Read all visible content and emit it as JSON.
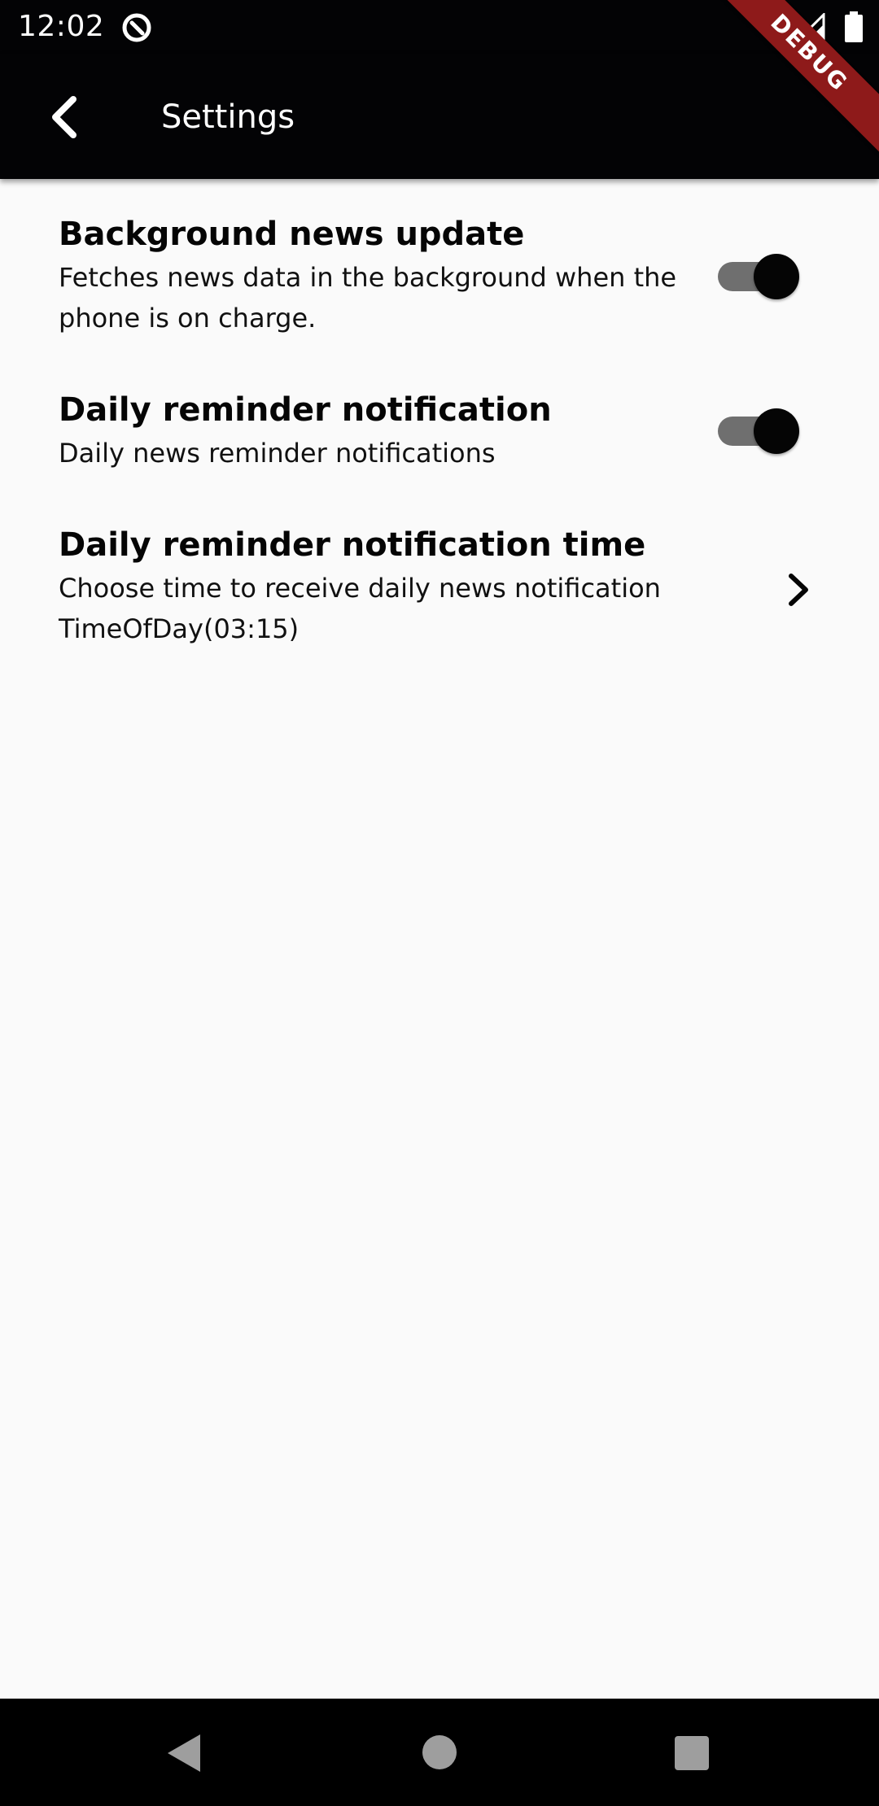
{
  "status_bar": {
    "time": "12:02",
    "icons": [
      "app-notification-icon",
      "wifi-icon",
      "signal-icon",
      "battery-icon"
    ]
  },
  "app_bar": {
    "title": "Settings",
    "back_icon": "back-arrow-icon"
  },
  "debug_banner": "DEBUG",
  "settings": {
    "background_update": {
      "title": "Background news update",
      "subtitle": "Fetches news data in the background when the phone is on charge.",
      "enabled": true
    },
    "daily_reminder": {
      "title": "Daily reminder notification",
      "subtitle": "Daily news reminder notifications",
      "enabled": true
    },
    "reminder_time": {
      "title": "Daily reminder notification time",
      "subtitle_line1": "Choose time to receive daily news notification",
      "subtitle_line2": "TimeOfDay(03:15)",
      "trailing_icon": "chevron-right-icon"
    }
  },
  "navigation_bar": {
    "buttons": [
      "nav-back-icon",
      "nav-home-icon",
      "nav-recents-icon"
    ]
  },
  "colors": {
    "app_bar_bg": "#030305",
    "page_bg": "#fafafa",
    "toggle_track": "#6f6f6f",
    "toggle_thumb": "#050505",
    "debug_banner": "#8e1a1a",
    "nav_button": "#9e9e9e"
  }
}
